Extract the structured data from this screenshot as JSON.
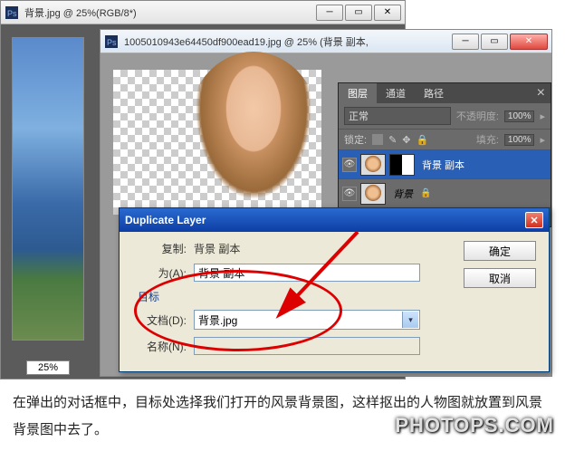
{
  "bgwin": {
    "title": "背景.jpg @ 25%(RGB/8*)",
    "zoom": "25%"
  },
  "fgwin": {
    "title": "1005010943e64450df900ead19.jpg @ 25% (背景 副本, "
  },
  "panel": {
    "tabs": {
      "layers": "图层",
      "channels": "通道",
      "paths": "路径"
    },
    "blendmode": "正常",
    "opacity_label": "不透明度:",
    "opacity_value": "100%",
    "lock_label": "锁定:",
    "fill_label": "填充:",
    "fill_value": "100%",
    "layers": [
      {
        "name": "背景 副本",
        "selected": true,
        "visible": true,
        "mask": true
      },
      {
        "name": "背景",
        "selected": false,
        "visible": true,
        "mask": false,
        "locked": true
      }
    ]
  },
  "dialog": {
    "title": "Duplicate Layer",
    "duplicate_label": "复制:",
    "duplicate_value": "背景 副本",
    "as_label": "为(A):",
    "as_value": "背景 副本",
    "dest_section": "目标",
    "document_label": "文档(D):",
    "document_value": "背景.jpg",
    "name_label": "名称(N):",
    "name_value": "",
    "ok": "确定",
    "cancel": "取消"
  },
  "caption": "在弹出的对话框中，目标处选择我们打开的风景背景图，这样抠出的人物图就放置到风景背景图中去了。",
  "watermark": "PHOTOPS.COM"
}
